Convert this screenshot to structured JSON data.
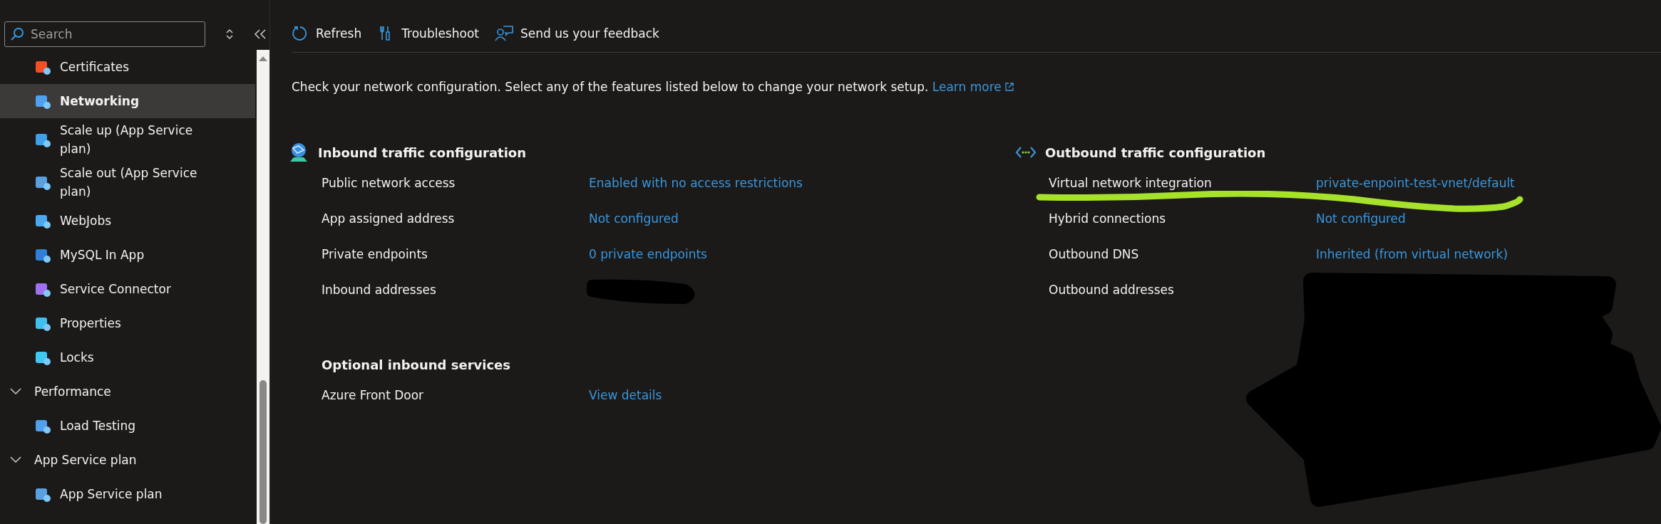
{
  "sidebar": {
    "search": {
      "placeholder": "Search"
    },
    "items": [
      {
        "kind": "item",
        "label": "Certificates",
        "selected": false
      },
      {
        "kind": "item",
        "label": "Networking",
        "selected": true
      },
      {
        "kind": "item",
        "label": "Scale up (App Service plan)",
        "selected": false
      },
      {
        "kind": "item",
        "label": "Scale out (App Service plan)",
        "selected": false
      },
      {
        "kind": "item",
        "label": "WebJobs",
        "selected": false
      },
      {
        "kind": "item",
        "label": "MySQL In App",
        "selected": false
      },
      {
        "kind": "item",
        "label": "Service Connector",
        "selected": false
      },
      {
        "kind": "item",
        "label": "Properties",
        "selected": false
      },
      {
        "kind": "item",
        "label": "Locks",
        "selected": false
      },
      {
        "kind": "group",
        "label": "Performance",
        "expanded": true,
        "children": [
          {
            "kind": "item",
            "label": "Load Testing",
            "selected": false
          }
        ]
      },
      {
        "kind": "group",
        "label": "App Service plan",
        "expanded": true,
        "children": [
          {
            "kind": "item",
            "label": "App Service plan",
            "selected": false
          }
        ]
      }
    ]
  },
  "toolbar": [
    {
      "label": "Refresh"
    },
    {
      "label": "Troubleshoot"
    },
    {
      "label": "Send us your feedback"
    }
  ],
  "description": {
    "text": "Check your network configuration. Select any of the features listed below to change your network setup.",
    "link": "Learn more"
  },
  "inbound": {
    "title": "Inbound traffic configuration",
    "rows": [
      {
        "label": "Public network access",
        "value": "Enabled with no access restrictions"
      },
      {
        "label": "App assigned address",
        "value": "Not configured"
      },
      {
        "label": "Private endpoints",
        "value": "0 private endpoints"
      },
      {
        "label": "Inbound addresses"
      }
    ],
    "optional_title": "Optional inbound services",
    "optional_rows": [
      {
        "label": "Azure Front Door",
        "value": "View details"
      }
    ]
  },
  "outbound": {
    "title": "Outbound traffic configuration",
    "rows": [
      {
        "label": "Virtual network integration",
        "value": "private-enpoint-test-vnet/default"
      },
      {
        "label": "Hybrid connections",
        "value": "Not configured"
      },
      {
        "label": "Outbound DNS",
        "value": "Inherited (from virtual network)"
      },
      {
        "label": "Outbound addresses"
      }
    ]
  }
}
